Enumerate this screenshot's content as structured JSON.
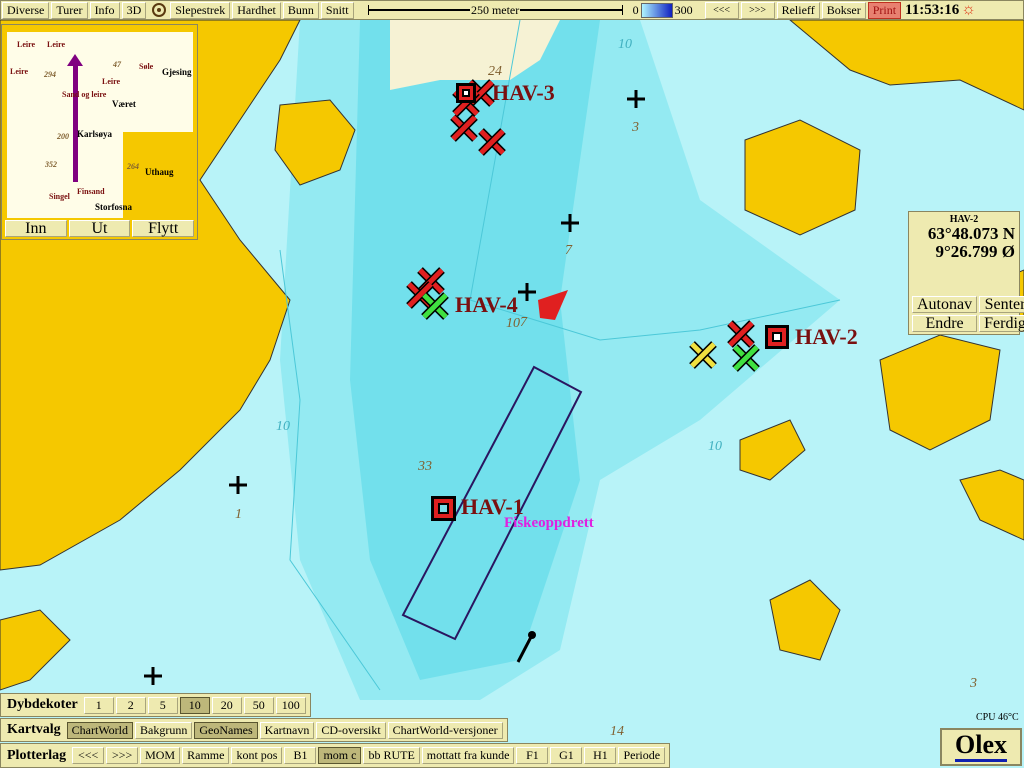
{
  "toolbar": {
    "items": [
      "Diverse",
      "Turer",
      "Info",
      "3D",
      "Slepestrek",
      "Hardhet",
      "Bunn",
      "Snitt"
    ],
    "scale_label": "250 meter",
    "depth_min": "0",
    "depth_max": "300",
    "right": [
      "<<<",
      ">>>",
      "Relieff",
      "Bokser"
    ],
    "print": "Print",
    "time": "11:53:16"
  },
  "minimap": {
    "buttons": [
      "Inn",
      "Ut",
      "Flytt"
    ],
    "labels": [
      "Leire",
      "Leire",
      "Leire",
      "Leire",
      "Søle",
      "Gjesing",
      "Været",
      "Karlsøya",
      "Uthaug",
      "Storfosna",
      "Sand og leire",
      "Singel",
      "Finsand",
      "294",
      "200",
      "352",
      "264",
      "47"
    ]
  },
  "info_panel": {
    "title": "HAV-2",
    "lat": "63°48.073 N",
    "lon": "9°26.799 Ø",
    "buttons": [
      "Autonav",
      "Senter",
      "Endre",
      "Ferdig"
    ]
  },
  "marks": {
    "hav1": "HAV-1",
    "hav2": "HAV-2",
    "hav3": "HAV-3",
    "hav4": "HAV-4",
    "fish_farm": "Fiskeoppdrett"
  },
  "depths": [
    "24",
    "3",
    "7",
    "7",
    "10",
    "33",
    "1",
    "14",
    "3",
    "10",
    "10",
    "10"
  ],
  "dybdekoter": {
    "label": "Dybdekoter",
    "options": [
      "1",
      "2",
      "5",
      "10",
      "20",
      "50",
      "100"
    ],
    "selected": "10"
  },
  "kartvalg": {
    "label": "Kartvalg",
    "options": [
      "ChartWorld",
      "Bakgrunn",
      "GeoNames",
      "Kartnavn",
      "CD-oversikt",
      "ChartWorld-versjoner"
    ],
    "selected": [
      "ChartWorld",
      "GeoNames"
    ]
  },
  "plotterlag": {
    "label": "Plotterlag",
    "options": [
      "<<<",
      ">>>",
      "MOM",
      "Ramme",
      "kont pos",
      "B1",
      "mom  c",
      "bb RUTE",
      "mottatt fra kunde",
      "F1",
      "G1",
      "H1",
      "Periode"
    ],
    "selected": "mom  c"
  },
  "cpu": "CPU 46°C",
  "logo": "Olex",
  "colors": {
    "land": "#f5c800",
    "water_deep": "#6edeec",
    "water_shallow": "#b8f3f8",
    "panel": "#eeeab0",
    "mark": "#e02020"
  }
}
